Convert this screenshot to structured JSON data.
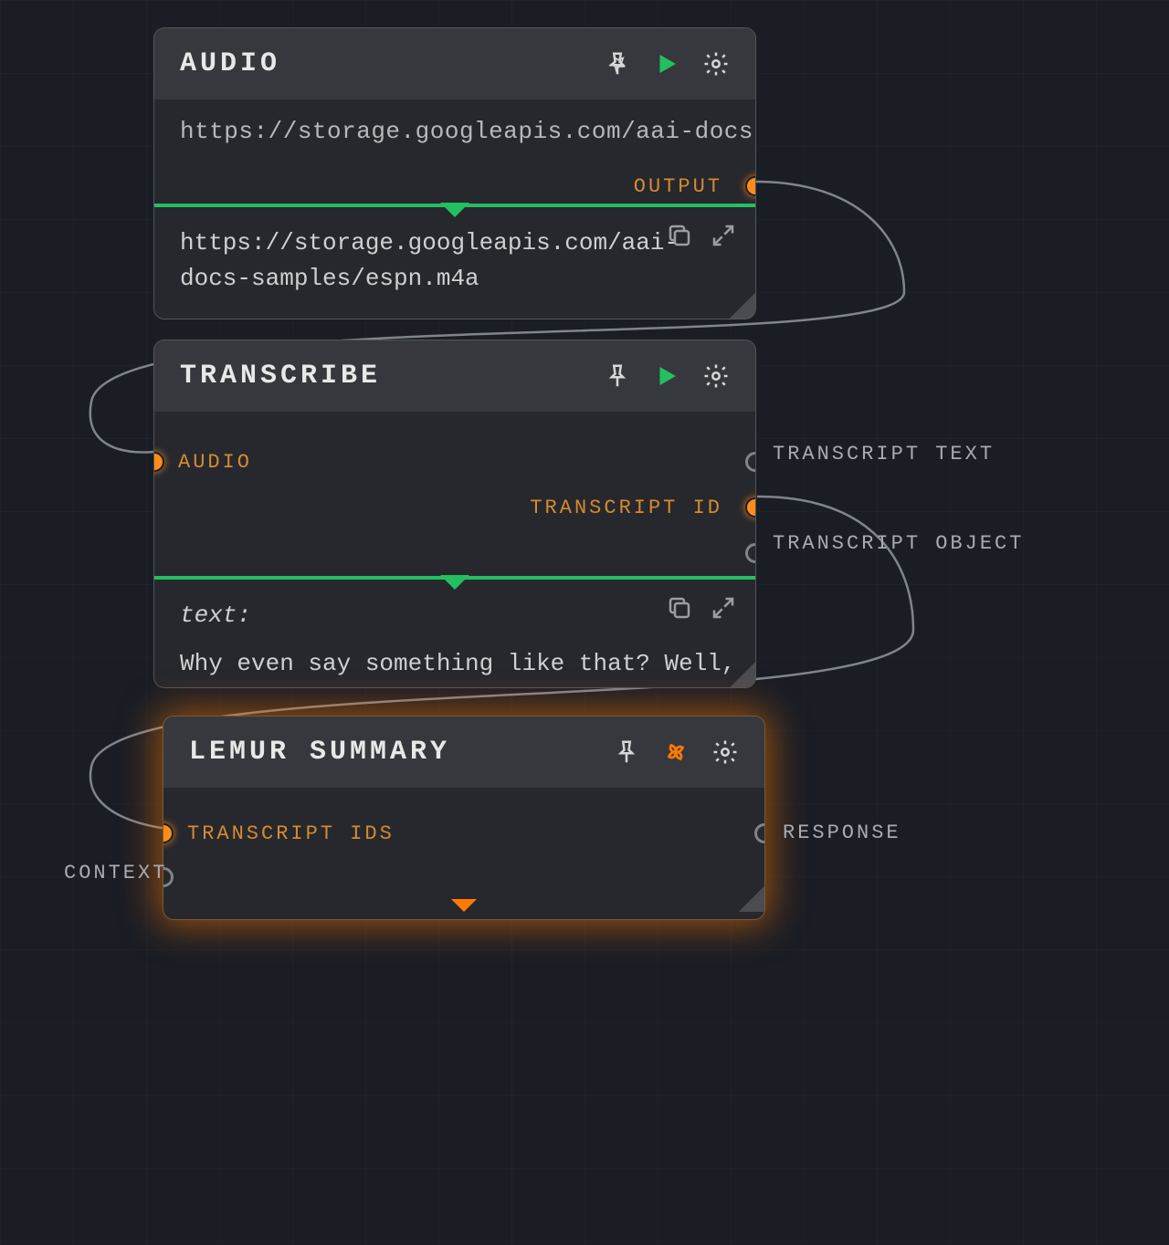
{
  "audio": {
    "title": "AUDIO",
    "input_url": "https://storage.googleapis.com/aai-docs-samples,",
    "output_label": "OUTPUT",
    "result_text": "https://storage.googleapis.com/aai-docs-samples/espn.m4a"
  },
  "transcribe": {
    "title": "TRANSCRIBE",
    "input_port_label": "AUDIO",
    "out1_label": "TRANSCRIPT TEXT",
    "out2_label": "TRANSCRIPT ID",
    "out3_label": "TRANSCRIPT OBJECT",
    "result_heading": "text:",
    "result_preview": "Why even say something like that? Well, he's"
  },
  "lemur": {
    "title": "LEMUR SUMMARY",
    "in1_label": "TRANSCRIPT IDS",
    "in2_label": "CONTEXT",
    "out_label": "RESPONSE"
  }
}
